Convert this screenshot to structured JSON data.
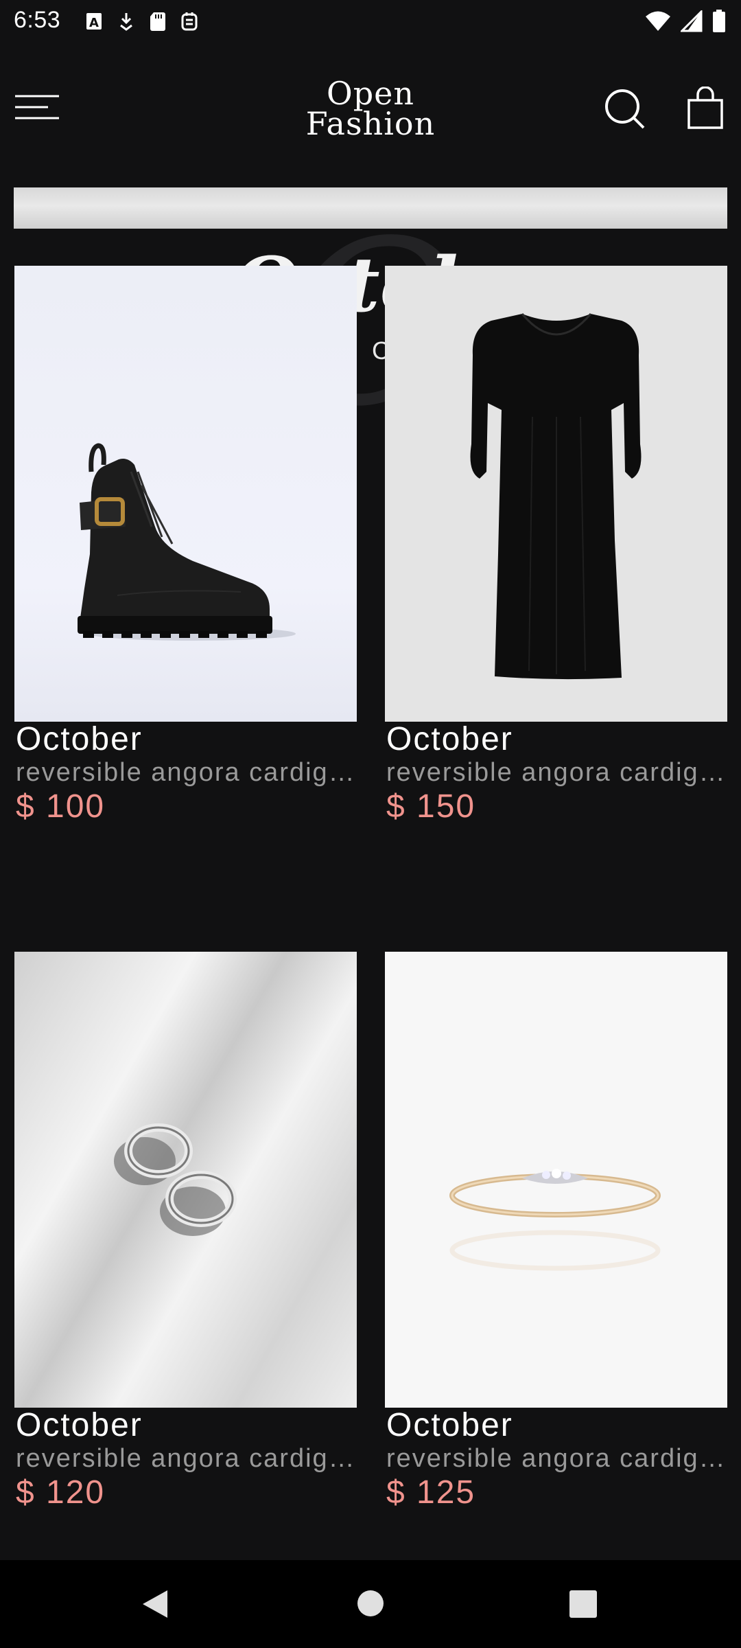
{
  "status_bar": {
    "time": "6:53",
    "left_icons": [
      "font-a-icon",
      "download-icon",
      "sd-card-icon",
      "shield-calendar-icon"
    ],
    "right_icons": [
      "wifi-icon",
      "signal-icon",
      "battery-icon"
    ]
  },
  "header": {
    "logo_line1": "Open",
    "logo_line2": "Fashion",
    "menu_icon": "hamburger-menu-icon",
    "search_icon": "search-icon",
    "cart_icon": "shopping-bag-icon"
  },
  "banner": {
    "partial_word": "Octob",
    "partial_sub": "E C"
  },
  "products": [
    {
      "name": "October",
      "description": "reversible angora cardigan",
      "price": "$ 100",
      "image": "black-boot"
    },
    {
      "name": "October",
      "description": "reversible angora cardigan",
      "price": "$ 150",
      "image": "black-dress"
    },
    {
      "name": "October",
      "description": "reversible angora cardigan",
      "price": "$ 120",
      "image": "silver-rings"
    },
    {
      "name": "October",
      "description": "reversible angora cardigan",
      "price": "$ 125",
      "image": "gold-ring"
    }
  ],
  "colors": {
    "background": "#111112",
    "price": "#f0938d",
    "description": "#9a9a9a"
  },
  "nav_bar": {
    "back": "back-triangle-icon",
    "home": "home-circle-icon",
    "recents": "recents-square-icon"
  }
}
